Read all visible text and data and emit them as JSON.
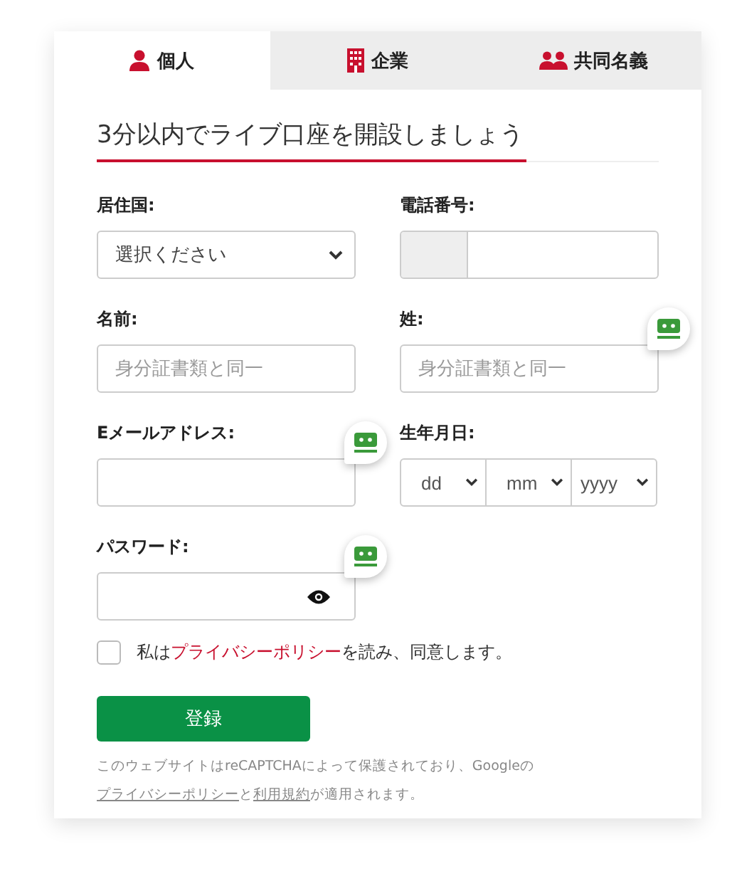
{
  "tabs": [
    {
      "label": "個人",
      "kind": "person",
      "selected": true
    },
    {
      "label": "企業",
      "kind": "building",
      "selected": false
    },
    {
      "label": "共同名義",
      "kind": "people",
      "selected": false
    }
  ],
  "heading": "3分以内でライブ口座を開設しましょう",
  "fields": [
    {
      "kind": "select",
      "label": "居住国:",
      "value": "選択ください",
      "badge": false
    },
    {
      "kind": "phone",
      "label": "電話番号:",
      "badge": false
    },
    {
      "kind": "text",
      "label": "名前:",
      "placeholder": "身分証書類と同一",
      "badge": false
    },
    {
      "kind": "text",
      "label": "姓:",
      "placeholder": "身分証書類と同一",
      "badge": true
    },
    {
      "kind": "text",
      "label": "Eメールアドレス:",
      "badge": true
    },
    {
      "kind": "date",
      "label": "生年月日:",
      "parts": [
        "dd",
        "mm",
        "yyyy"
      ],
      "badge": false
    },
    {
      "kind": "password",
      "label": "パスワード:",
      "badge": true
    }
  ],
  "consent": {
    "checked": false,
    "parts": [
      {
        "text": "私は",
        "link": false
      },
      {
        "text": "プライバシーポリシー",
        "link": true
      },
      {
        "text": "を読み、同意します。",
        "link": false
      }
    ]
  },
  "submit": "登録",
  "notice": [
    {
      "text": "このウェブサイトはreCAPTCHAによって保護されており、Googleの",
      "link": false
    },
    {
      "text": "プライバシーポリシー",
      "link": true
    },
    {
      "text": "と",
      "link": false
    },
    {
      "text": "利用規約",
      "link": true
    },
    {
      "text": "が適用されます。",
      "link": false
    }
  ]
}
